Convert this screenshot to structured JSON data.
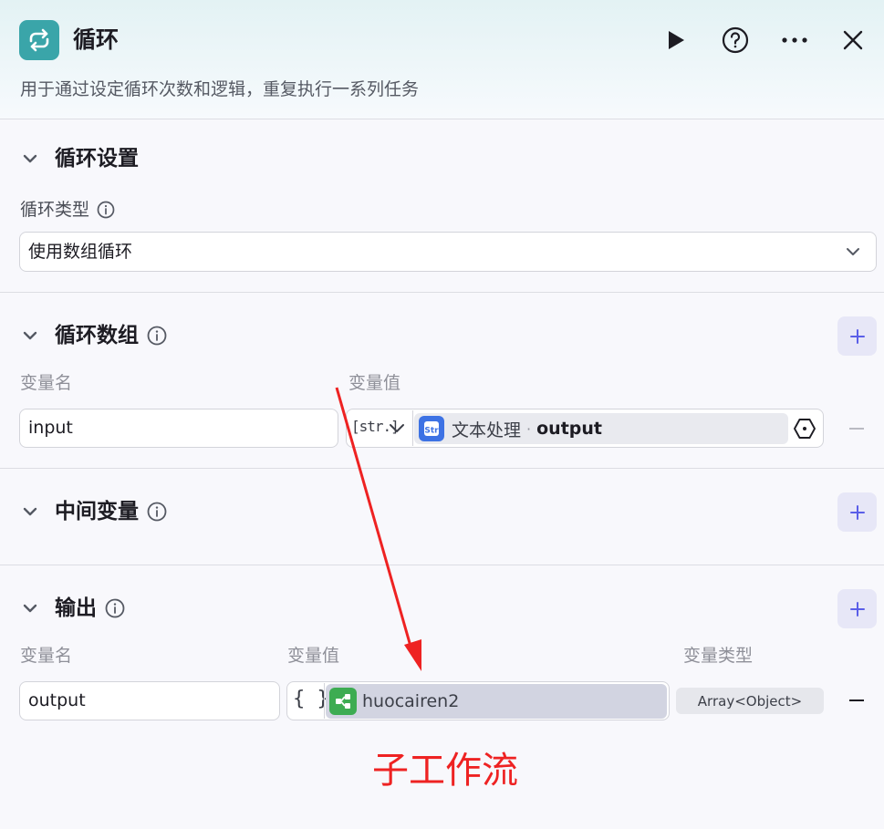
{
  "header": {
    "title": "循环",
    "description": "用于通过设定循环次数和逻辑，重复执行一系列任务",
    "accent_color": "#3aa5a9"
  },
  "loop_settings": {
    "title": "循环设置",
    "type_label": "循环类型",
    "type_value": "使用数组循环"
  },
  "loop_array": {
    "title": "循环数组",
    "col_name": "变量名",
    "col_value": "变量值",
    "row": {
      "name": "input",
      "type_tag": "[str.]",
      "ref_node": "文本处理",
      "ref_sep": "·",
      "ref_field": "output"
    }
  },
  "intermediate": {
    "title": "中间变量"
  },
  "output": {
    "title": "输出",
    "col_name": "变量名",
    "col_value": "变量值",
    "col_type": "变量类型",
    "row": {
      "name": "output",
      "type_tag": "{ }",
      "ref_node": "huocairen2",
      "var_type": "Array<Object>"
    }
  },
  "annotation": {
    "text": "子工作流",
    "color": "#ee2222"
  }
}
